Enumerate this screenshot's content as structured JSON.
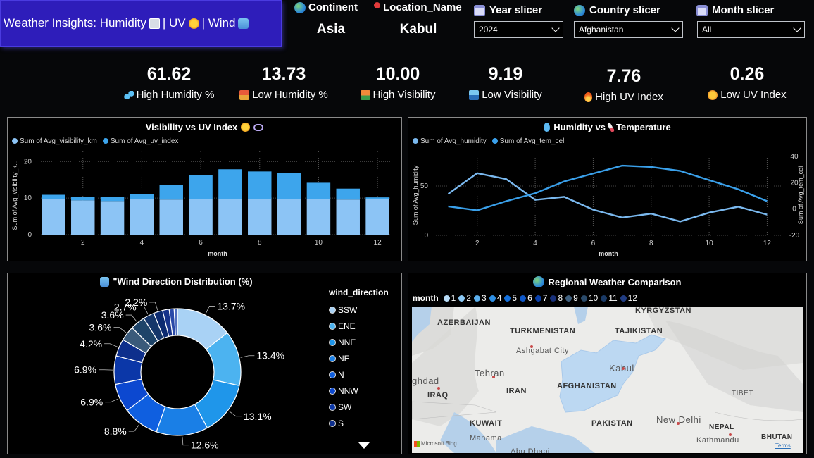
{
  "header": {
    "title_text": "Weather Insights: Humidity ",
    "title_sep1": " | UV ",
    "title_sep2": " | Wind ",
    "continent_label": "Continent",
    "continent_value": "Asia",
    "location_label": "Location_Name",
    "location_value": "Kabul"
  },
  "slicers": [
    {
      "label": "Year slicer",
      "value": "2024",
      "icon": "calendar-icon"
    },
    {
      "label": "Country slicer",
      "value": "Afghanistan",
      "icon": "globe-icon"
    },
    {
      "label": "Month slicer",
      "value": "All",
      "icon": "calendar-icon"
    }
  ],
  "kpis": [
    {
      "value": "61.62",
      "label": "High Humidity %",
      "icon": "droplets-icon"
    },
    {
      "value": "13.73",
      "label": "Low Humidity %",
      "icon": "desert-icon"
    },
    {
      "value": "10.00",
      "label": "High Visibility",
      "icon": "sunrise-icon"
    },
    {
      "value": "9.19",
      "label": "Low Visibility",
      "icon": "fog-icon"
    },
    {
      "value": "7.76",
      "label": "High UV Index",
      "icon": "fire-icon"
    },
    {
      "value": "0.26",
      "label": "Low UV Index",
      "icon": "sun-icon"
    }
  ],
  "vis_chart": {
    "title": "Visibility vs UV Index",
    "legend": [
      "Sum of Avg_visibility_km",
      "Sum of Avg_uv_index"
    ],
    "ylabel": "Sum of Avg_visibility_k...",
    "xlabel": "month",
    "yticks": [
      "0",
      "10",
      "20"
    ],
    "xticks": [
      "2",
      "4",
      "6",
      "8",
      "10",
      "12"
    ]
  },
  "hum_chart": {
    "title": "Humidity vs",
    "title2": "Temperature",
    "legend": [
      "Sum of Avg_humidity",
      "Sum of Avg_tem_cel"
    ],
    "ylabel": "Sum of Avg_humidity",
    "ylabel2": "Sum of Avg_tem_cel",
    "xlabel": "month",
    "yticks": [
      "0",
      "50"
    ],
    "y2ticks": [
      "-20",
      "0",
      "20",
      "40"
    ],
    "xticks": [
      "2",
      "4",
      "6",
      "8",
      "10",
      "12"
    ]
  },
  "donut": {
    "title": "\"Wind Direction Distribution (%)",
    "legend_title": "wind_direction",
    "legend": [
      "SSW",
      "ENE",
      "NNE",
      "NE",
      "N",
      "NNW",
      "SW",
      "S"
    ],
    "labels": [
      "13.7%",
      "13.4%",
      "13.1%",
      "12.6%",
      "8.8%",
      "6.9%",
      "6.9%",
      "4.2%",
      "3.6%",
      "3.6%",
      "2.7%",
      "2.2%"
    ]
  },
  "map": {
    "title": "Regional Weather Comparison",
    "legend_title": "month",
    "months": [
      "1",
      "2",
      "3",
      "4",
      "5",
      "6",
      "7",
      "8",
      "9",
      "10",
      "11",
      "12"
    ],
    "labels": {
      "kyrgyzstan": "KYRGYZSTAN",
      "azerbaijan": "AZERBAIJAN",
      "turkmenistan": "TURKMENISTAN",
      "tajikistan": "TAJIKISTAN",
      "ashgabat": "Ashgabat City",
      "kabul": "Kabul",
      "tehran": "Tehran",
      "afghanistan": "AFGHANISTAN",
      "iran": "IRAN",
      "ghdad": "ghdad",
      "iraq": "IRAQ",
      "tibet": "TIBET",
      "newdelhi": "New Delhi",
      "pakistan": "PAKISTAN",
      "kuwait": "KUWAIT",
      "nepal": "NEPAL",
      "bhutan": "BHUTAN",
      "manama": "Manama",
      "kathmandu": "Kathmandu",
      "abudhabi": "Abu Dhabi"
    },
    "attribution": "Microsoft Bing",
    "terms": "Terms"
  },
  "colors": {
    "accent_purple": "#2e1dba",
    "series_light": "#8cc4f5",
    "series_mid": "#3da5ec",
    "line_humidity": "#7ab8ee",
    "line_temp": "#3aa0ea",
    "donut": [
      "#a9d2f5",
      "#4cb3f0",
      "#1f96ea",
      "#1a7fe6",
      "#0f5fe0",
      "#0c48d0",
      "#0b37a8",
      "#0e2f8c",
      "#3a5a7a",
      "#1e4469",
      "#15366a",
      "#0c2a70",
      "#17338a",
      "#2a4aa8",
      "#5070c0"
    ],
    "month": [
      "#b8dcf8",
      "#8cc8f4",
      "#5cb0ee",
      "#2f8fe4",
      "#1470dc",
      "#0e57c8",
      "#0a3fa8",
      "#18307a",
      "#40607e",
      "#2a4a6a",
      "#1a3a66",
      "#203c82"
    ]
  },
  "chart_data": [
    {
      "type": "bar",
      "title": "Visibility vs UV Index",
      "xlabel": "month",
      "ylabel": "Sum of Avg_visibility_k...",
      "stacked": true,
      "categories": [
        1,
        2,
        3,
        4,
        5,
        6,
        7,
        8,
        9,
        10,
        11,
        12
      ],
      "series": [
        {
          "name": "Sum of Avg_visibility_km",
          "values": [
            9.7,
            9.4,
            9.2,
            9.8,
            9.6,
            9.7,
            9.8,
            9.7,
            9.7,
            9.8,
            9.6,
            9.8
          ]
        },
        {
          "name": "Sum of Avg_uv_index",
          "values": [
            1.2,
            1.0,
            1.1,
            1.2,
            4.0,
            6.6,
            8.1,
            7.6,
            7.2,
            4.4,
            3.0,
            0.4
          ]
        }
      ],
      "ylim": [
        0,
        22
      ],
      "xlim": [
        0.5,
        12.5
      ]
    },
    {
      "type": "line",
      "title": "Humidity vs Temperature",
      "xlabel": "month",
      "ylabel": "Sum of Avg_humidity",
      "ylabel2": "Sum of Avg_tem_cel",
      "x": [
        1,
        2,
        3,
        4,
        5,
        6,
        7,
        8,
        9,
        10,
        11,
        12
      ],
      "series": [
        {
          "name": "Sum of Avg_humidity",
          "axis": "left",
          "values": [
            42,
            63,
            57,
            36,
            39,
            26,
            18,
            22,
            14,
            23,
            29,
            21
          ]
        },
        {
          "name": "Sum of Avg_tem_cel",
          "axis": "right",
          "values": [
            2,
            -1,
            6,
            12,
            21,
            27,
            33,
            32,
            29,
            22,
            15,
            6
          ]
        }
      ],
      "ylim": [
        0,
        80
      ],
      "y2lim": [
        -20,
        40
      ],
      "xlim": [
        0.5,
        12.5
      ]
    },
    {
      "type": "pie",
      "title": "\"Wind Direction Distribution (%)",
      "values": [
        13.7,
        13.4,
        13.1,
        12.6,
        8.8,
        6.9,
        6.9,
        4.2,
        3.6,
        3.6,
        2.7,
        2.2,
        1.6,
        1.2,
        0.8
      ],
      "labels_shown": [
        "13.7%",
        "13.4%",
        "13.1%",
        "12.6%",
        "8.8%",
        "6.9%",
        "6.9%",
        "4.2%",
        "3.6%",
        "3.6%",
        "2.7%",
        "2.2%"
      ]
    }
  ]
}
